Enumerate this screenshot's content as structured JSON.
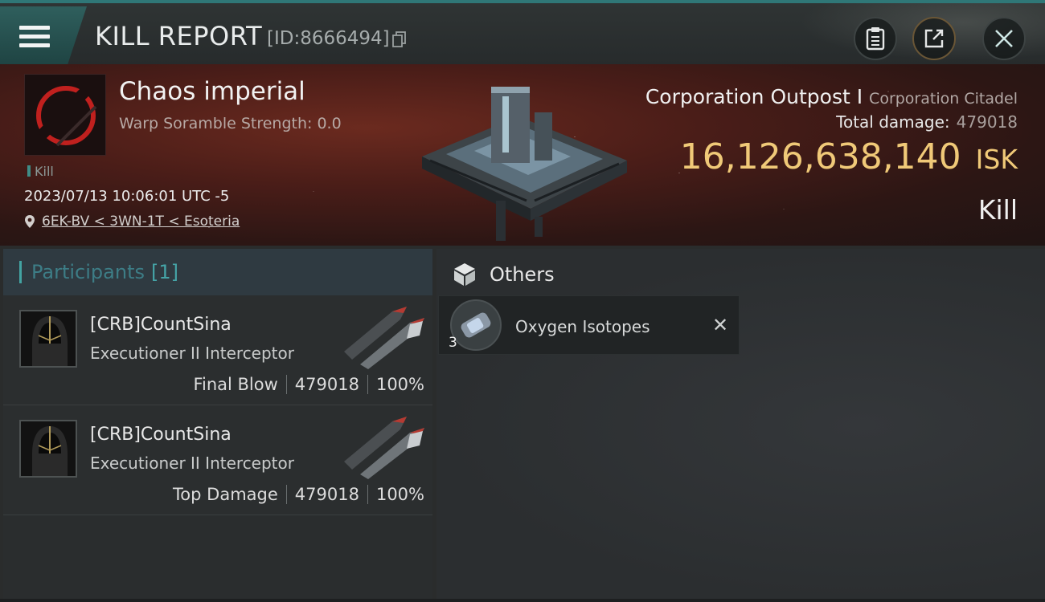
{
  "header": {
    "title": "KILL REPORT",
    "report_id": "[ID:8666494]"
  },
  "icons": {
    "menu": "menu-icon",
    "copy": "copy-icon",
    "clipboard": "clipboard-icon",
    "share": "share-icon",
    "close": "close-icon",
    "location": "location-pin-icon",
    "cargo": "cargo-box-icon"
  },
  "victim": {
    "name": "Chaos imperial",
    "warp_scramble": "Warp Soramble Strength: 0.0",
    "tag": "Kill",
    "datetime": "2023/07/13 10:06:01 UTC -5",
    "location": "6EK-BV < 3WN-1T < Esoteria"
  },
  "target": {
    "name": "Corporation Outpost I",
    "type": "Corporation Citadel",
    "total_damage_label": "Total damage:",
    "total_damage": "479018",
    "isk_value": "16,126,638,140",
    "isk_unit": "ISK",
    "result": "Kill"
  },
  "participants": {
    "title": "Participants",
    "count": "[1]",
    "rows": [
      {
        "name": "[CRB]CountSina",
        "ship": "Executioner II Interceptor",
        "role": "Final Blow",
        "damage": "479018",
        "percent": "100%"
      },
      {
        "name": "[CRB]CountSina",
        "ship": "Executioner II Interceptor",
        "role": "Top Damage",
        "damage": "479018",
        "percent": "100%"
      }
    ]
  },
  "others": {
    "title": "Others",
    "items": [
      {
        "name": "Oxygen Isotopes",
        "qty": "3"
      }
    ]
  },
  "colors": {
    "accent": "#43a3a2",
    "isk": "#f0c978",
    "banner": "#4a1d18"
  }
}
